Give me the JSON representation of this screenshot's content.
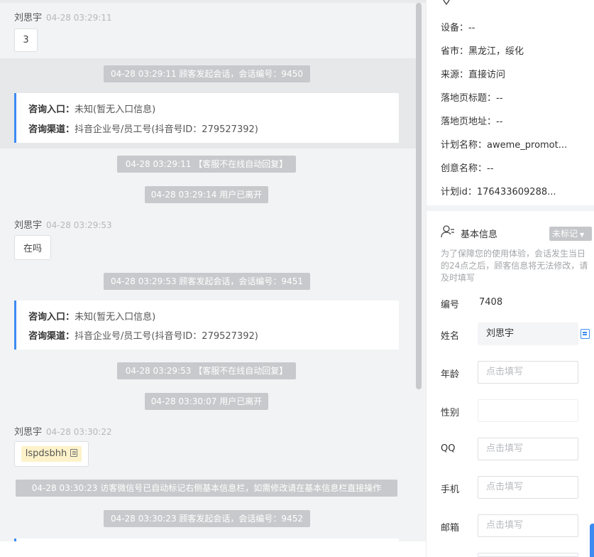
{
  "chat": {
    "messages": [
      {
        "name": "刘思宇",
        "time": "04-28 03:29:11",
        "text": "3"
      },
      {
        "name": "刘思宇",
        "time": "04-28 03:29:53",
        "text": "在吗"
      },
      {
        "name": "刘思宇",
        "time": "04-28 03:30:22",
        "text": "lspdsbhh"
      }
    ],
    "system": {
      "s1": "04-28 03:29:11 顾客发起会话，会话编号：9450",
      "s2": "04-28 03:29:11 【客服不在线自动回复】",
      "s3": "04-28 03:29:14 用户已离开",
      "s4": "04-28 03:29:53 顾客发起会话，会话编号：9451",
      "s5": "04-28 03:29:53 【客服不在线自动回复】",
      "s6": "04-28 03:30:07 用户已离开",
      "s7": "04-28 03:30:23 访客微信号已自动标记右侧基本信息栏，如需修改请在基本信息栏直接操作",
      "s8": "04-28 03:30:23 顾客发起会话，会话编号：9452"
    },
    "info_cards": [
      {
        "entry_label": "咨询入口：",
        "entry_value": "未知(暂无入口信息)",
        "channel_label": "咨询渠道：",
        "channel_value": "抖音企业号/员工号(抖音号ID：279527392)"
      },
      {
        "entry_label": "咨询入口：",
        "entry_value": "未知(暂无入口信息)",
        "channel_label": "咨询渠道：",
        "channel_value": "抖音企业号/员工号(抖音号ID：279527392)"
      }
    ]
  },
  "source_info": {
    "device": "设备：--",
    "province_city": "省市：黑龙江，绥化",
    "source": "来源：直接访问",
    "landing_title": "落地页标题：--",
    "landing_url": "落地页地址：--",
    "plan_name": "计划名称：aweme_promot...",
    "creative_name": "创意名称：--",
    "plan_id": "计划id：176433609288..."
  },
  "basic_info": {
    "title": "基本信息",
    "tag_dropdown": "未标记",
    "tip": "为了保障您的使用体验，会话发生当日的24点之后，顾客信息将无法修改，请及时填写",
    "fields": {
      "id_label": "编号",
      "id_value": "7408",
      "name_label": "姓名",
      "name_value": "刘思宇",
      "age_label": "年龄",
      "age_placeholder": "点击填写",
      "gender_label": "性别",
      "qq_label": "QQ",
      "qq_placeholder": "点击填写",
      "phone_label": "手机",
      "phone_placeholder": "点击填写",
      "email_label": "邮箱",
      "email_placeholder": "点击填写"
    }
  },
  "colors": {
    "accent": "#3d8bf2",
    "system_bg": "#c8c9cc",
    "highlight": "#fdf2c9"
  }
}
